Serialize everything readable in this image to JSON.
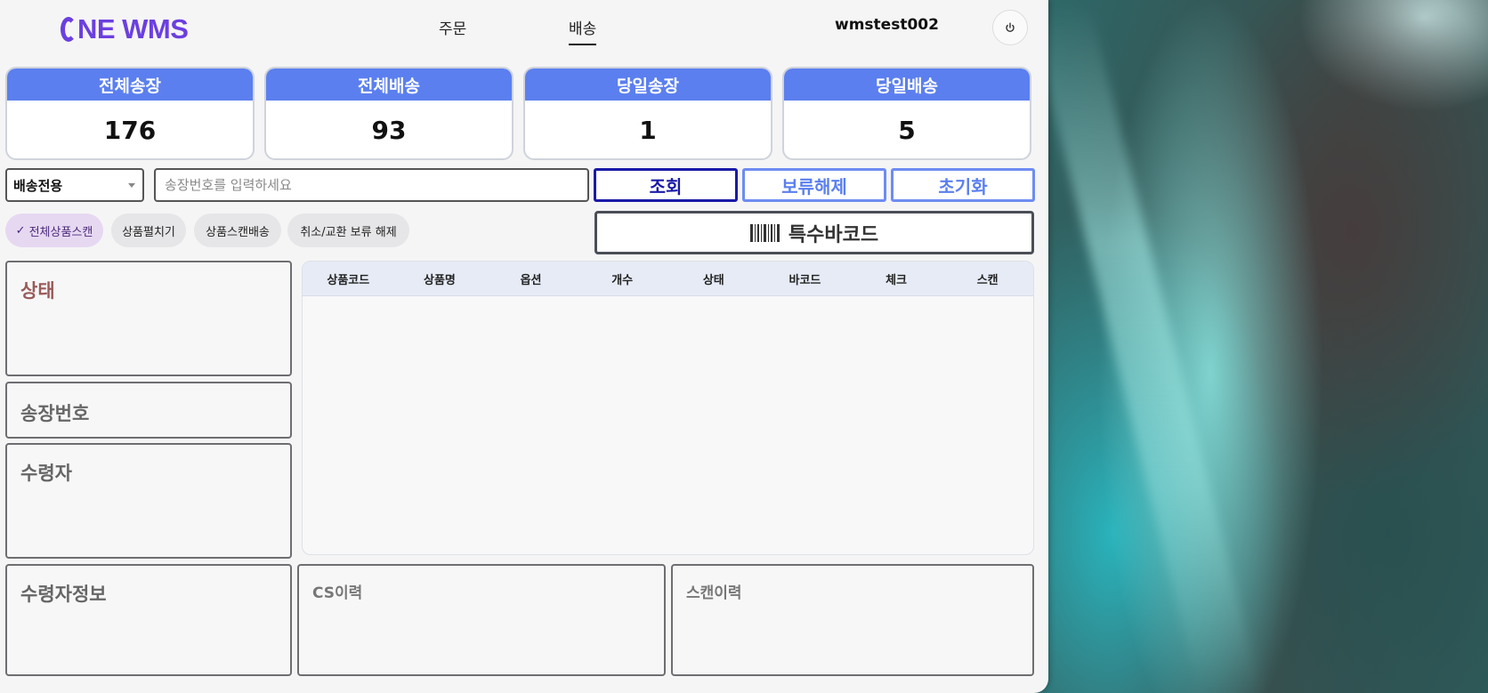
{
  "header": {
    "logo": "ONE WMS",
    "nav": [
      "주문",
      "배송"
    ],
    "active_nav": "배송",
    "user": "wmstest002",
    "power_icon": "power-icon"
  },
  "stats": [
    {
      "label": "전체송장",
      "value": "176"
    },
    {
      "label": "전체배송",
      "value": "93"
    },
    {
      "label": "당일송장",
      "value": "1"
    },
    {
      "label": "당일배송",
      "value": "5"
    }
  ],
  "search": {
    "mode_selected": "배송전용",
    "placeholder": "송장번호를 입력하세요",
    "value": ""
  },
  "buttons": {
    "lookup": "조회",
    "release_hold": "보류해제",
    "reset": "초기화",
    "special_barcode": "특수바코드"
  },
  "colors": {
    "accent": "#5b7fef",
    "lookup_border": "#1a1aa8",
    "outline_blue": "#5b7fef",
    "logo": "#6b3fe0"
  },
  "chips": [
    {
      "label": "전체상품스캔",
      "selected": true,
      "check": "✓"
    },
    {
      "label": "상품펼치기",
      "selected": false
    },
    {
      "label": "상품스캔배송",
      "selected": false
    },
    {
      "label": "취소/교환 보류 해제",
      "selected": false
    }
  ],
  "panels": {
    "status": "상태",
    "invoice_no": "송장번호",
    "recipient": "수령자",
    "recipient_info": "수령자정보",
    "cs_history": "CS이력",
    "scan_history": "스캔이력"
  },
  "table": {
    "columns": [
      "상품코드",
      "상품명",
      "옵션",
      "개수",
      "상태",
      "바코드",
      "체크",
      "스캔"
    ],
    "rows": []
  }
}
